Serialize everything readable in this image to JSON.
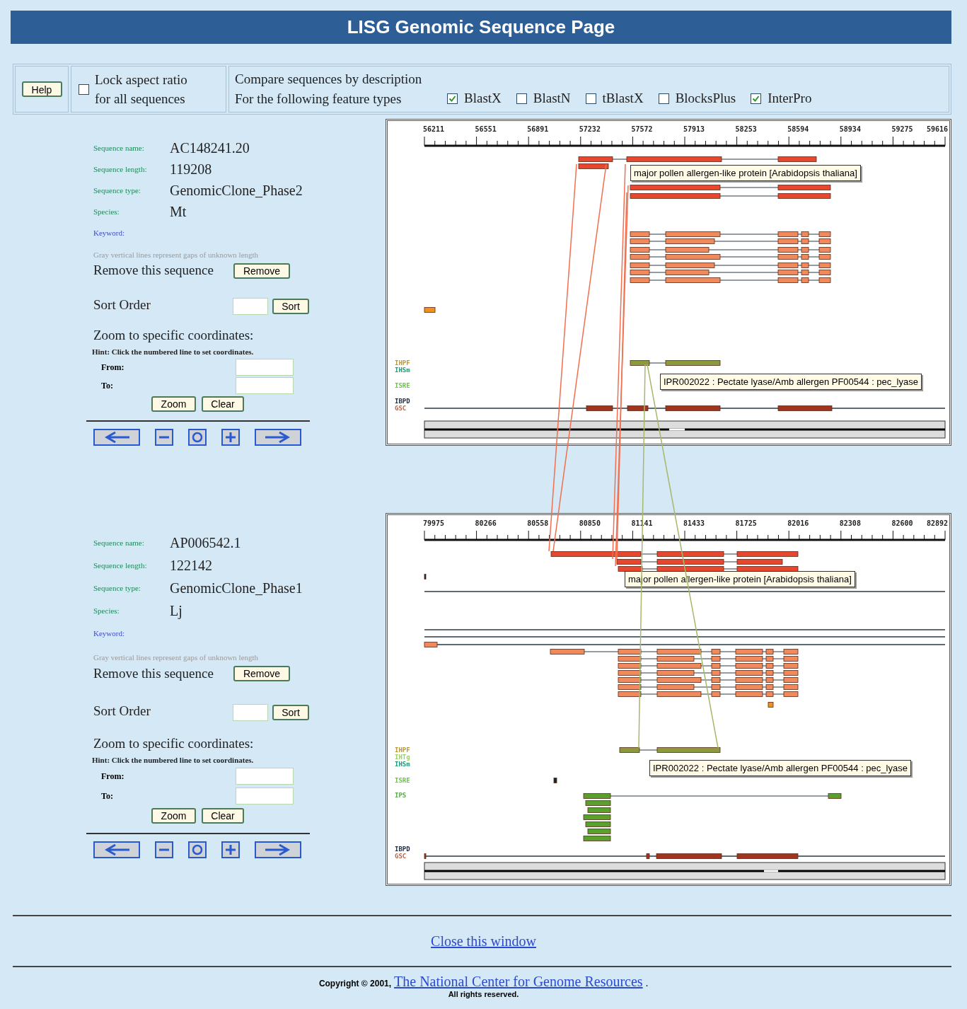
{
  "title": "LISG Genomic Sequence Page",
  "toolbar": {
    "help_button": "Help",
    "lock": {
      "lines": [
        "Lock aspect ratio",
        "for all sequences"
      ],
      "checked": false
    },
    "compare": {
      "line1": "Compare sequences by description",
      "line2": "For the following feature types",
      "feature_types": [
        {
          "label": "BlastX",
          "checked": true
        },
        {
          "label": "BlastN",
          "checked": false
        },
        {
          "label": "tBlastX",
          "checked": false
        },
        {
          "label": "BlocksPlus",
          "checked": false
        },
        {
          "label": "InterPro",
          "checked": true
        }
      ]
    }
  },
  "sequences": [
    {
      "fields": [
        {
          "label": "Sequence name:",
          "value": "AC148241.20"
        },
        {
          "label": "Sequence length:",
          "value": "119208"
        },
        {
          "label": "Sequence type:",
          "value": "GenomicClone_Phase2"
        },
        {
          "label": "Species:",
          "value": "Mt"
        }
      ],
      "keyword_label": "Keyword:",
      "gap_note": "Gray vertical lines represent gaps of unknown length",
      "remove_label": "Remove this sequence",
      "remove_button": "Remove",
      "sort_label": "Sort Order",
      "sort_button": "Sort",
      "zoom_title": "Zoom to specific coordinates:",
      "hint": "Hint: Click the numbered line to set coordinates.",
      "from_label": "From:",
      "to_label": "To:",
      "zoom_button": "Zoom",
      "clear_button": "Clear",
      "viewer": {
        "ticks": [
          "56211",
          "56551",
          "56891",
          "57232",
          "57572",
          "57913",
          "58253",
          "58594",
          "58934",
          "59275",
          "59616"
        ],
        "track_labels": [
          {
            "label": "IHPF",
            "color": "#b59a3a"
          },
          {
            "label": "IHSm",
            "color": "#1f9a7a"
          },
          {
            "label": "ISRE",
            "color": "#6cc24a"
          },
          {
            "label": "IBPD",
            "color": "#1a2a3a"
          },
          {
            "label": "GSC",
            "color": "#b5664a"
          }
        ],
        "tooltips": [
          "major  pollen allergen-like protein [Arabidopsis thaliana]",
          "IPR002022  : Pectate lyase/Amb allergen  PF00544 : pec_lyase"
        ]
      }
    },
    {
      "fields": [
        {
          "label": "Sequence name:",
          "value": "AP006542.1"
        },
        {
          "label": "Sequence length:",
          "value": "122142"
        },
        {
          "label": "Sequence type:",
          "value": "GenomicClone_Phase1"
        },
        {
          "label": "Species:",
          "value": "Lj"
        }
      ],
      "keyword_label": "Keyword:",
      "gap_note": "Gray vertical lines represent gaps of unknown length",
      "remove_label": "Remove this sequence",
      "remove_button": "Remove",
      "sort_label": "Sort Order",
      "sort_button": "Sort",
      "zoom_title": "Zoom to specific coordinates:",
      "hint": "Hint: Click the numbered line to set coordinates.",
      "from_label": "From:",
      "to_label": "To:",
      "zoom_button": "Zoom",
      "clear_button": "Clear",
      "viewer": {
        "ticks": [
          "79975",
          "80266",
          "80558",
          "80850",
          "81141",
          "81433",
          "81725",
          "82016",
          "82308",
          "82600",
          "82892"
        ],
        "track_labels": [
          {
            "label": "IHPF",
            "color": "#b59a3a"
          },
          {
            "label": "IHTg",
            "color": "#9ccf6a"
          },
          {
            "label": "IHSm",
            "color": "#1f9a7a"
          },
          {
            "label": "ISRE",
            "color": "#6cc24a"
          },
          {
            "label": "IPS",
            "color": "#5aa84a"
          },
          {
            "label": "IBPD",
            "color": "#1a2a3a"
          },
          {
            "label": "GSC",
            "color": "#b5664a"
          }
        ],
        "tooltips": [
          "major  pollen allergen-like protein [Arabidopsis thaliana]",
          "IPR002022  : Pectate lyase/Amb allergen  PF00544 : pec_lyase"
        ]
      }
    }
  ],
  "close_link": "Close this window",
  "footer": {
    "copyright": "Copyright © 2001,",
    "org_link": "The National Center for Genome Resources",
    "period": ".",
    "rights": "All rights reserved."
  }
}
